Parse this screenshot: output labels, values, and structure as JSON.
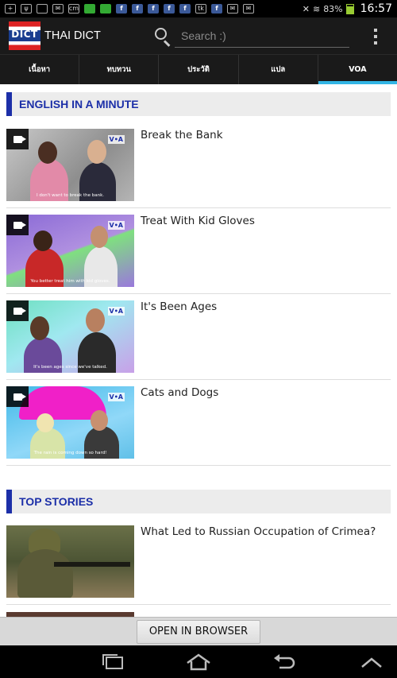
{
  "status": {
    "battery": "83%",
    "time": "16:57",
    "notif_icons": [
      "plus-icon",
      "usb-icon",
      "image-icon",
      "mail-icon",
      "cm-icon",
      "photo-icon",
      "message-icon",
      "facebook-icon",
      "facebook-icon",
      "facebook-icon",
      "facebook-icon",
      "facebook-icon",
      "talk-icon",
      "facebook-icon",
      "mail-icon",
      "mail-icon"
    ]
  },
  "app": {
    "logo_text": "DICT",
    "title": "THAI DICT",
    "search_placeholder": "Search :)"
  },
  "tabs": [
    {
      "label": "เนื้อหา",
      "active": false
    },
    {
      "label": "ทบทวน",
      "active": false
    },
    {
      "label": "ประวัติ",
      "active": false
    },
    {
      "label": "แปล",
      "active": false
    },
    {
      "label": "VOA",
      "active": true
    }
  ],
  "sections": [
    {
      "title": "ENGLISH IN A MINUTE",
      "items": [
        {
          "title": "Break the Bank",
          "caption": "I don't want to break the bank.",
          "badge": "V•A"
        },
        {
          "title": "Treat With Kid Gloves",
          "caption": "You better treat him with kid gloves.",
          "badge": "V•A"
        },
        {
          "title": "It's Been Ages",
          "caption": "It's been ages since we've talked.",
          "badge": "V•A"
        },
        {
          "title": "Cats and Dogs",
          "caption": "The rain is coming down so hard!",
          "badge": "V•A"
        }
      ]
    },
    {
      "title": "TOP STORIES",
      "items": [
        {
          "title": "What Led to Russian Occupation of Crimea?"
        }
      ]
    }
  ],
  "footer": {
    "button_label": "OPEN IN BROWSER"
  },
  "colors": {
    "accent": "#33b5e5",
    "section_blue": "#1c2fa8",
    "status_green": "#99cc33"
  }
}
